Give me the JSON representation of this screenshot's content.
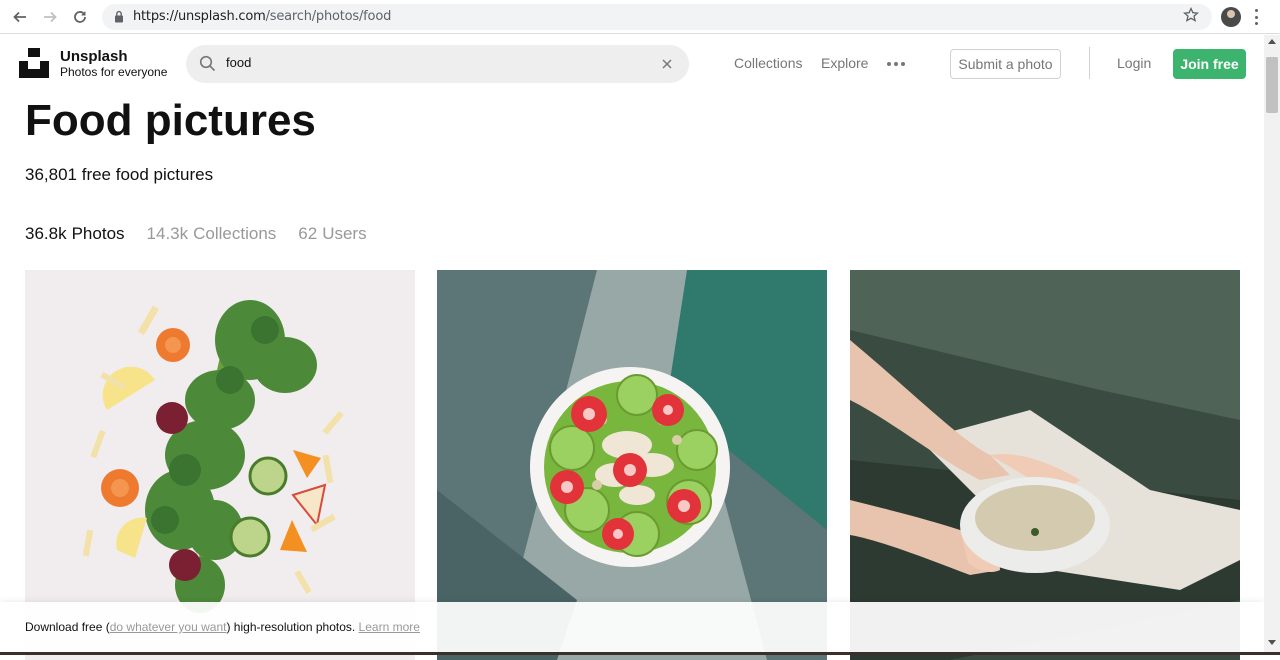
{
  "browser": {
    "url_host": "https://unsplash.com",
    "url_path": "/search/photos/food"
  },
  "header": {
    "brand_name": "Unsplash",
    "brand_tagline": "Photos for everyone",
    "search_value": "food",
    "nav": [
      "Collections",
      "Explore"
    ],
    "submit_label": "Submit a photo",
    "login_label": "Login",
    "join_label": "Join free",
    "accent_color": "#3cb46e"
  },
  "main": {
    "title": "Food pictures",
    "subtitle": "36,801 free food pictures",
    "tabs": [
      {
        "count": "36.8k",
        "label": "Photos",
        "active": true
      },
      {
        "count": "14.3k",
        "label": "Collections",
        "active": false
      },
      {
        "count": "62",
        "label": "Users",
        "active": false
      }
    ]
  },
  "banner": {
    "prefix": "Download free (",
    "link1": "do whatever you want",
    "middle": ") high-resolution photos. ",
    "link2": "Learn more"
  }
}
